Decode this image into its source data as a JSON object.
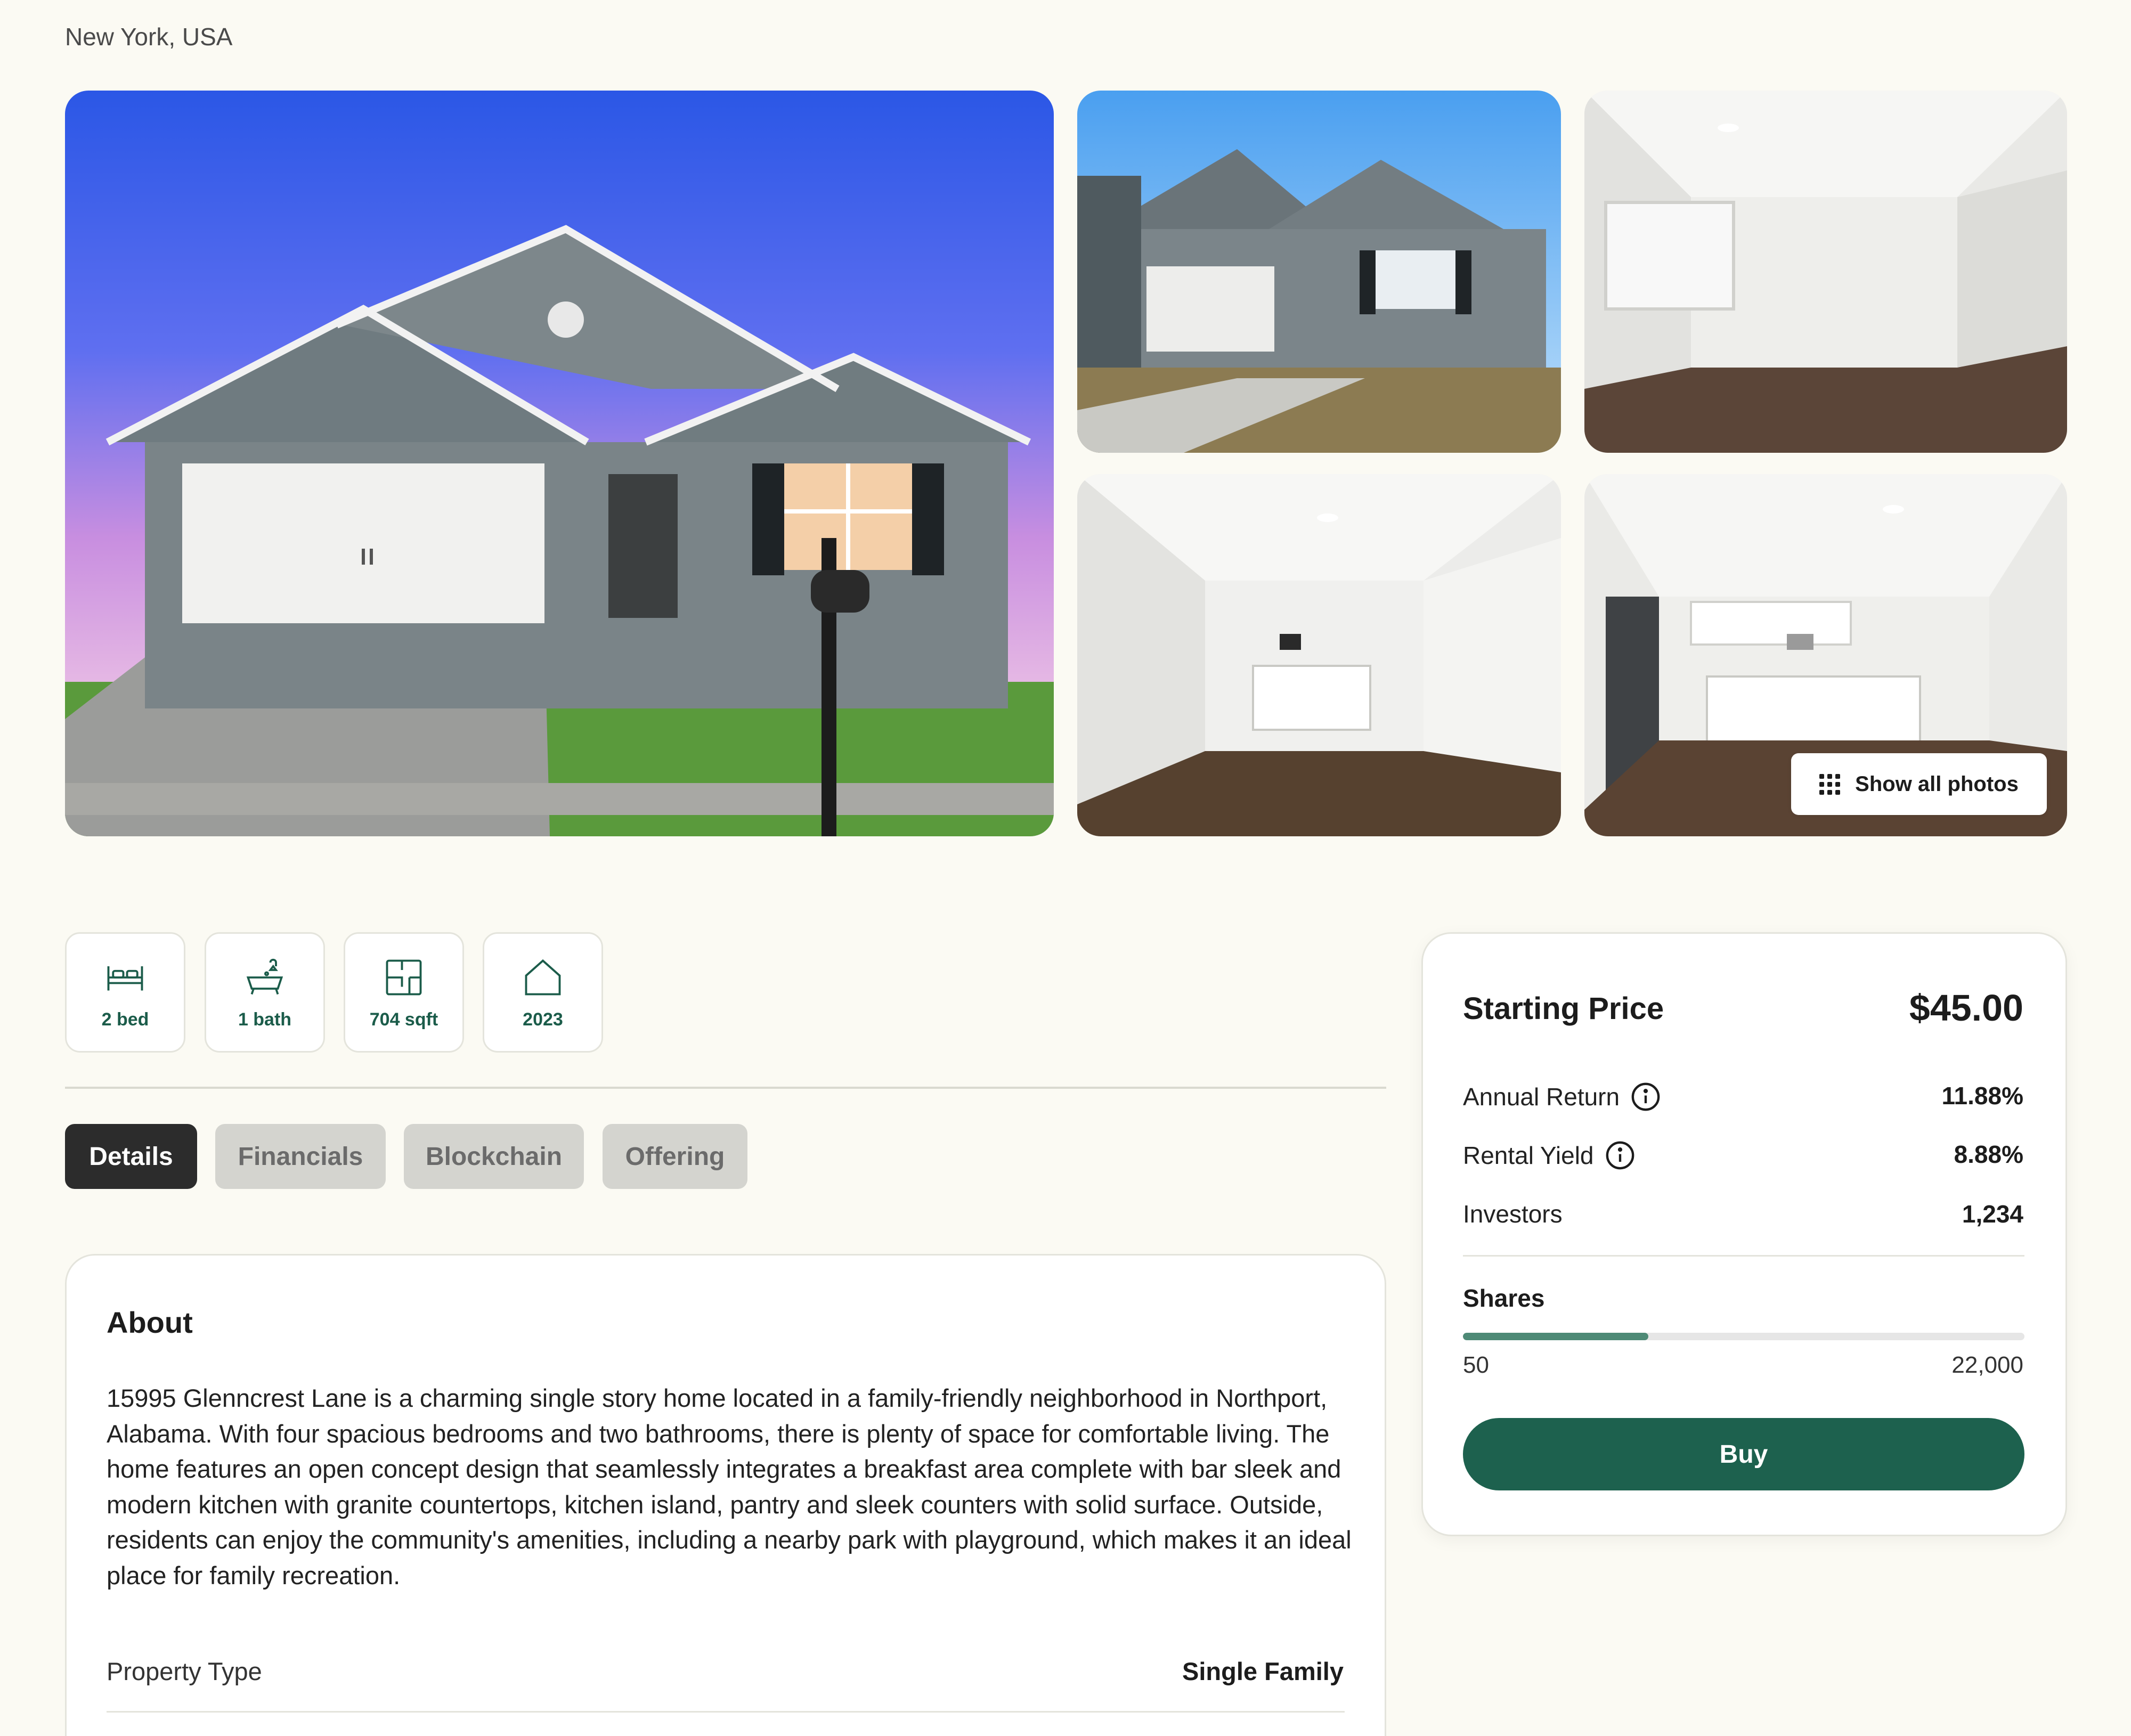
{
  "location": "New York, USA",
  "gallery": {
    "show_all_label": "Show all photos",
    "photos": [
      "house-exterior-dusk",
      "house-exterior-day",
      "living-room",
      "open-living-kitchen",
      "kitchen"
    ]
  },
  "features": [
    {
      "icon": "bed-icon",
      "label": "2 bed"
    },
    {
      "icon": "bath-icon",
      "label": "1 bath"
    },
    {
      "icon": "floorplan-icon",
      "label": "704 sqft"
    },
    {
      "icon": "home-icon",
      "label": "2023"
    }
  ],
  "tabs": [
    {
      "label": "Details",
      "active": true
    },
    {
      "label": "Financials",
      "active": false
    },
    {
      "label": "Blockchain",
      "active": false
    },
    {
      "label": "Offering",
      "active": false
    }
  ],
  "about": {
    "title": "About",
    "text": "15995 Glenncrest Lane is a charming single story home located in a family-friendly neighborhood in Northport, Alabama. With four spacious bedrooms and two bathrooms, there is plenty of space for comfortable living. The home features an open concept design that seamlessly integrates a breakfast area complete with bar sleek and modern kitchen with granite countertops, kitchen island, pantry and sleek counters with solid surface. Outside, residents can enjoy the community's amenities, including a nearby park with playground, which makes it an ideal place for family recreation.",
    "property_type_label": "Property Type",
    "property_type_value": "Single Family"
  },
  "pricing": {
    "starting_price_label": "Starting Price",
    "starting_price_value": "$45.00",
    "annual_return_label": "Annual Return",
    "annual_return_value": "11.88%",
    "rental_yield_label": "Rental Yield",
    "rental_yield_value": "8.88%",
    "investors_label": "Investors",
    "investors_value": "1,234",
    "shares_label": "Shares",
    "shares_min": "50",
    "shares_max": "22,000",
    "shares_progress_percent": 33,
    "buy_label": "Buy"
  },
  "colors": {
    "background": "#fbfaf3",
    "accent_green": "#1d614e",
    "progress_green": "#4e8a76",
    "active_tab": "#2c2c2c",
    "inactive_tab": "#d4d4cf"
  }
}
